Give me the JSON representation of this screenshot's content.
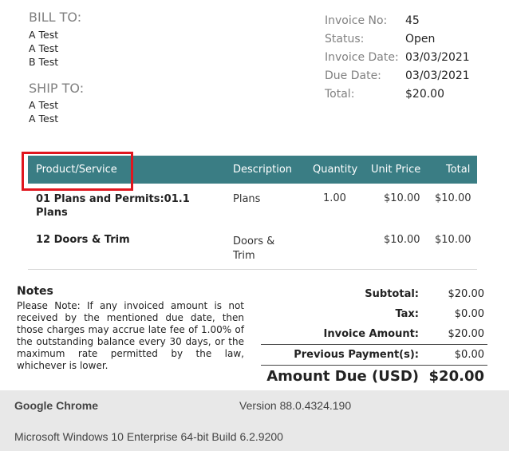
{
  "bill_to": {
    "label": "BILL TO:",
    "lines": [
      "A Test",
      "A Test",
      "B Test"
    ]
  },
  "ship_to": {
    "label": "SHIP TO:",
    "lines": [
      "A Test",
      "A Test"
    ]
  },
  "invoice": {
    "labels": [
      "Invoice No:",
      "Status:",
      "Invoice Date:",
      "Due Date:",
      "Total:"
    ],
    "values": [
      "45",
      "Open",
      "03/03/2021",
      "03/03/2021",
      "$20.00"
    ]
  },
  "table": {
    "headers": [
      "Product/Service",
      "Description",
      "Quantity",
      "Unit Price",
      "Total"
    ],
    "rows": [
      {
        "product_line1": "01 Plans and Permits:01.1",
        "product_line2": "Plans",
        "description_line1": "Plans",
        "description_line2": "",
        "quantity": "1.00",
        "unit_price": "$10.00",
        "total": "$10.00"
      },
      {
        "product_line1": "12 Doors & Trim",
        "product_line2": "",
        "description_line1": "Doors &",
        "description_line2": "Trim",
        "quantity": "",
        "unit_price": "$10.00",
        "total": "$10.00"
      }
    ]
  },
  "notes": {
    "title": "Notes",
    "text": "Please Note: If any invoiced amount is not received by the mentioned due date, then those charges may accrue late fee of 1.00% of the outstanding balance every 30 days, or the maximum rate permitted by the law, whichever is lower."
  },
  "totals": {
    "subtotal_label": "Subtotal:",
    "subtotal": "$20.00",
    "tax_label": "Tax:",
    "tax": "$0.00",
    "invoice_amount_label": "Invoice Amount:",
    "invoice_amount": "$20.00",
    "previous_payments_label": "Previous Payment(s):",
    "previous_payments": "$0.00",
    "amount_due_label": "Amount Due (USD)",
    "amount_due": "$20.00"
  },
  "footer": {
    "browser": "Google Chrome",
    "version": "Version 88.0.4324.190",
    "os": "Microsoft Windows 10 Enterprise 64-bit Build 6.2.9200"
  },
  "colors": {
    "table_header": "#3a7d84",
    "highlight": "#e0161f",
    "footer_bg": "#e8e8e8"
  }
}
